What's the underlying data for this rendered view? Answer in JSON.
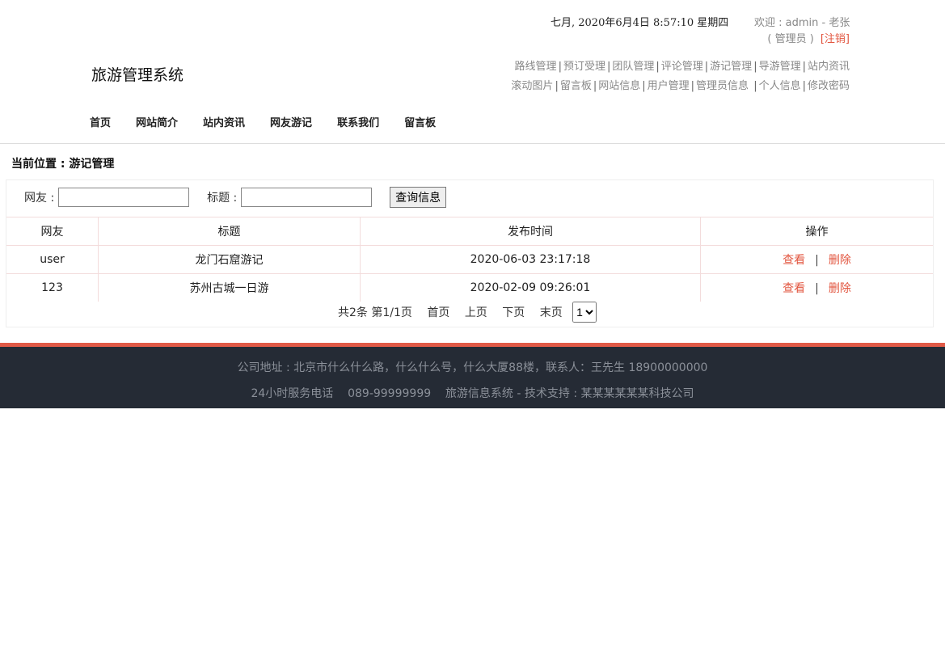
{
  "header": {
    "datetime": "七月, 2020年6月4日 8:57:10 星期四",
    "welcome": "欢迎 : admin - 老张",
    "role": "( 管理员 )",
    "logout": "[注销]",
    "site_title": "旅游管理系统",
    "admin_links_row1": [
      "路线管理",
      "预订受理",
      "团队管理",
      "评论管理",
      "游记管理",
      "导游管理",
      "站内资讯"
    ],
    "admin_links_row2": [
      "滚动图片",
      "留言板",
      "网站信息",
      "用户管理",
      "管理员信息",
      "个人信息",
      "修改密码"
    ],
    "nav": [
      "首页",
      "网站简介",
      "站内资讯",
      "网友游记",
      "联系我们",
      "留言板"
    ]
  },
  "breadcrumb": "当前位置 : 游记管理",
  "search": {
    "user_label": "网友 :",
    "user_value": "",
    "title_label": "标题 :",
    "title_value": "",
    "button": "查询信息"
  },
  "table": {
    "columns": [
      "网友",
      "标题",
      "发布时间",
      "操作"
    ],
    "rows": [
      {
        "user": "user",
        "title": "龙门石窟游记",
        "time": "2020-06-03 23:17:18",
        "view": "查看",
        "sep": "|",
        "del": "删除"
      },
      {
        "user": "123",
        "title": "苏州古城一日游",
        "time": "2020-02-09 09:26:01",
        "view": "查看",
        "sep": "|",
        "del": "删除"
      }
    ]
  },
  "pager": {
    "total": "共2条",
    "page": "第1/1页",
    "first": "首页",
    "prev": "上页",
    "next": "下页",
    "last": "末页",
    "selected": "1"
  },
  "footer": {
    "line1": "公司地址 : 北京市什么什么路，什么什么号，什么大厦88楼，联系人：王先生 18900000000",
    "line2": "24小时服务电话    089-99999999    旅游信息系统 - 技术支持 : 某某某某某某科技公司"
  },
  "colors": {
    "accent": "#e2553f",
    "footer_bg": "#252b35",
    "footer_border": "#e05a47"
  }
}
